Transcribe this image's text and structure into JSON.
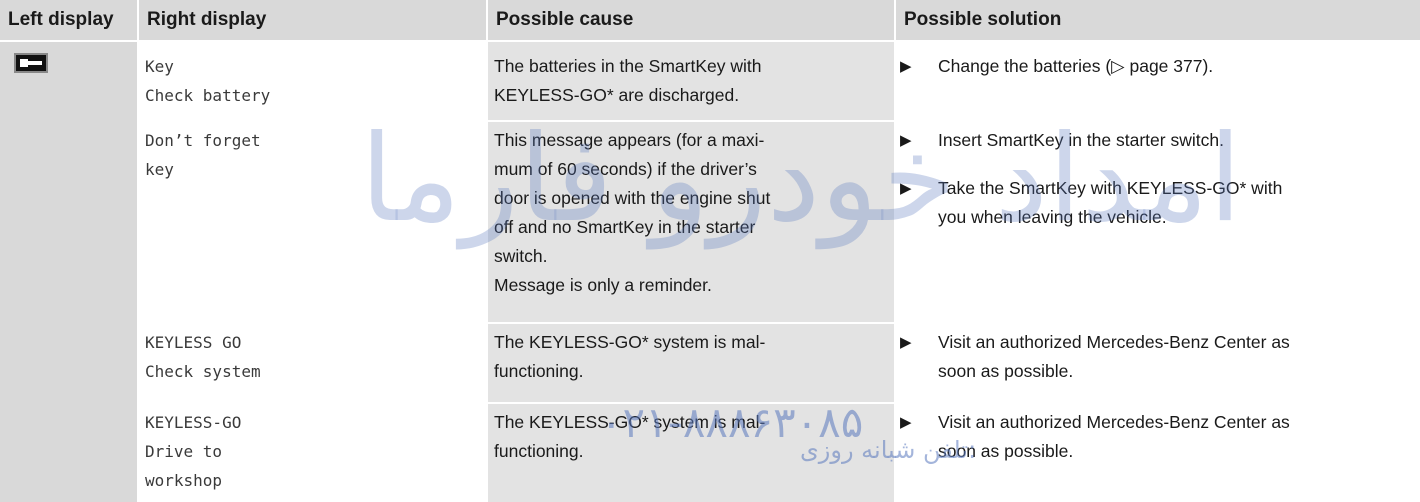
{
  "headers": {
    "left": "Left display",
    "right": "Right display",
    "cause": "Possible cause",
    "solution": "Possible solution"
  },
  "rows": [
    {
      "right_display": "Key\nCheck battery",
      "cause": "The batteries in the SmartKey with\nKEYLESS-GO* are discharged.",
      "solutions": [
        "Change the batteries (▷ page 377)."
      ]
    },
    {
      "right_display": "Don’t forget\nkey",
      "cause": "This message appears (for a maxi-\nmum of 60 seconds) if the driver’s\ndoor is opened with the engine shut\noff and no SmartKey in the starter\nswitch.\nMessage is only a reminder.",
      "solutions": [
        "Insert SmartKey in the starter switch.",
        "Take the SmartKey with KEYLESS-GO* with\nyou when leaving the vehicle."
      ]
    },
    {
      "right_display": "KEYLESS GO\nCheck system",
      "cause": "The KEYLESS-GO* system is mal-\nfunctioning.",
      "solutions": [
        "Visit an authorized Mercedes-Benz Center as\nsoon as possible."
      ]
    },
    {
      "right_display": "KEYLESS-GO\nDrive to\nworkshop",
      "cause": "The KEYLESS-GO* system is mal-\nfunctioning.",
      "solutions": [
        "Visit an authorized Mercedes-Benz Center as\nsoon as possible."
      ]
    }
  ],
  "bullet_glyph": "▶",
  "left_display_icon": "key-battery-icon",
  "watermark": {
    "text": "امداد خودرو فارما",
    "phone": "۰۲۱-۸۸۸۶۳۰۸۵",
    "caption": "تلفن شبانه روزی:"
  },
  "colors": {
    "header_bg": "#d9d9d9",
    "cause_bg": "#e3e3e3",
    "watermark": "#5a78be"
  }
}
